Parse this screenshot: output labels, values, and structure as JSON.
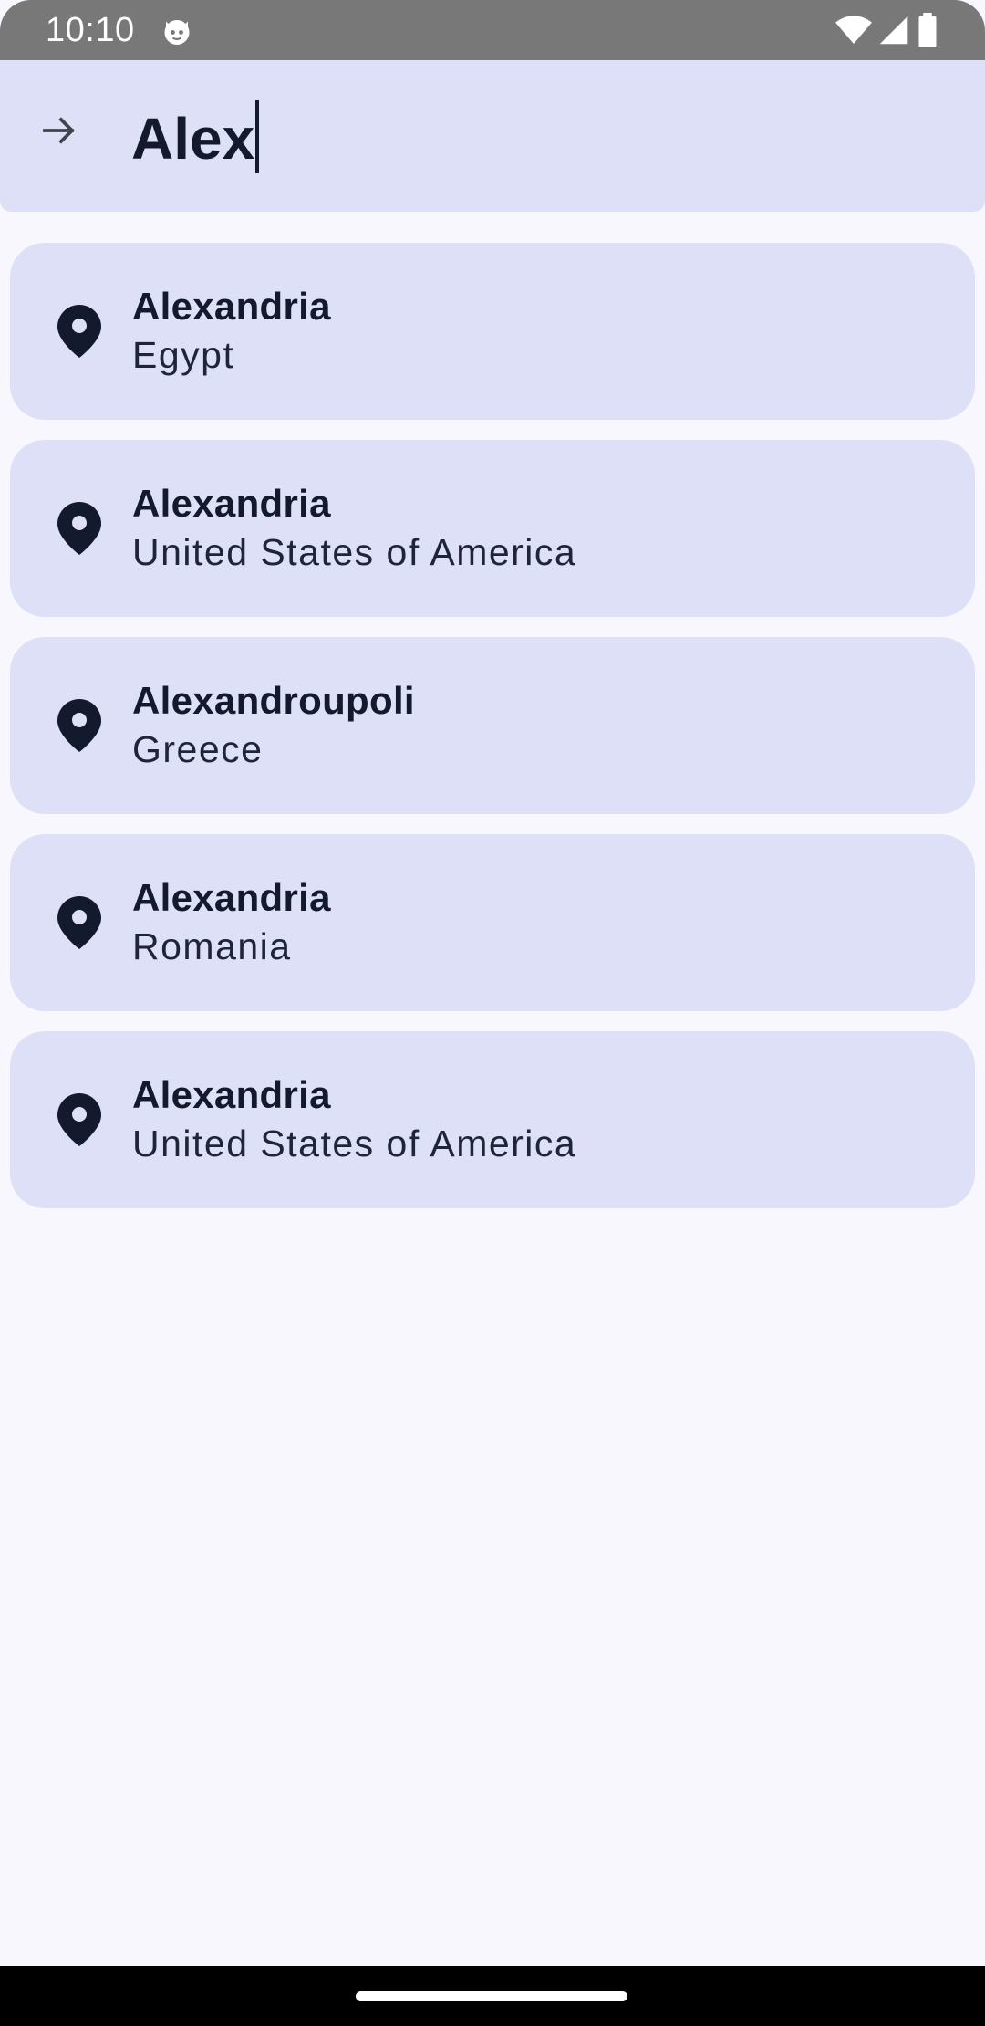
{
  "status_bar": {
    "time": "10:10",
    "icons": [
      "cat-icon",
      "wifi-icon",
      "signal-icon",
      "battery-icon"
    ]
  },
  "search": {
    "query": "Alex",
    "back_icon": "arrow-right-icon"
  },
  "results": [
    {
      "city": "Alexandria",
      "country": "Egypt"
    },
    {
      "city": "Alexandria",
      "country": "United States of America"
    },
    {
      "city": "Alexandroupoli",
      "country": "Greece"
    },
    {
      "city": "Alexandria",
      "country": "Romania"
    },
    {
      "city": "Alexandria",
      "country": "United States of America"
    }
  ],
  "colors": {
    "surface": "#dde0f6",
    "background": "#f8f7fe",
    "on_surface": "#141a2e",
    "status_bar": "#787878"
  }
}
